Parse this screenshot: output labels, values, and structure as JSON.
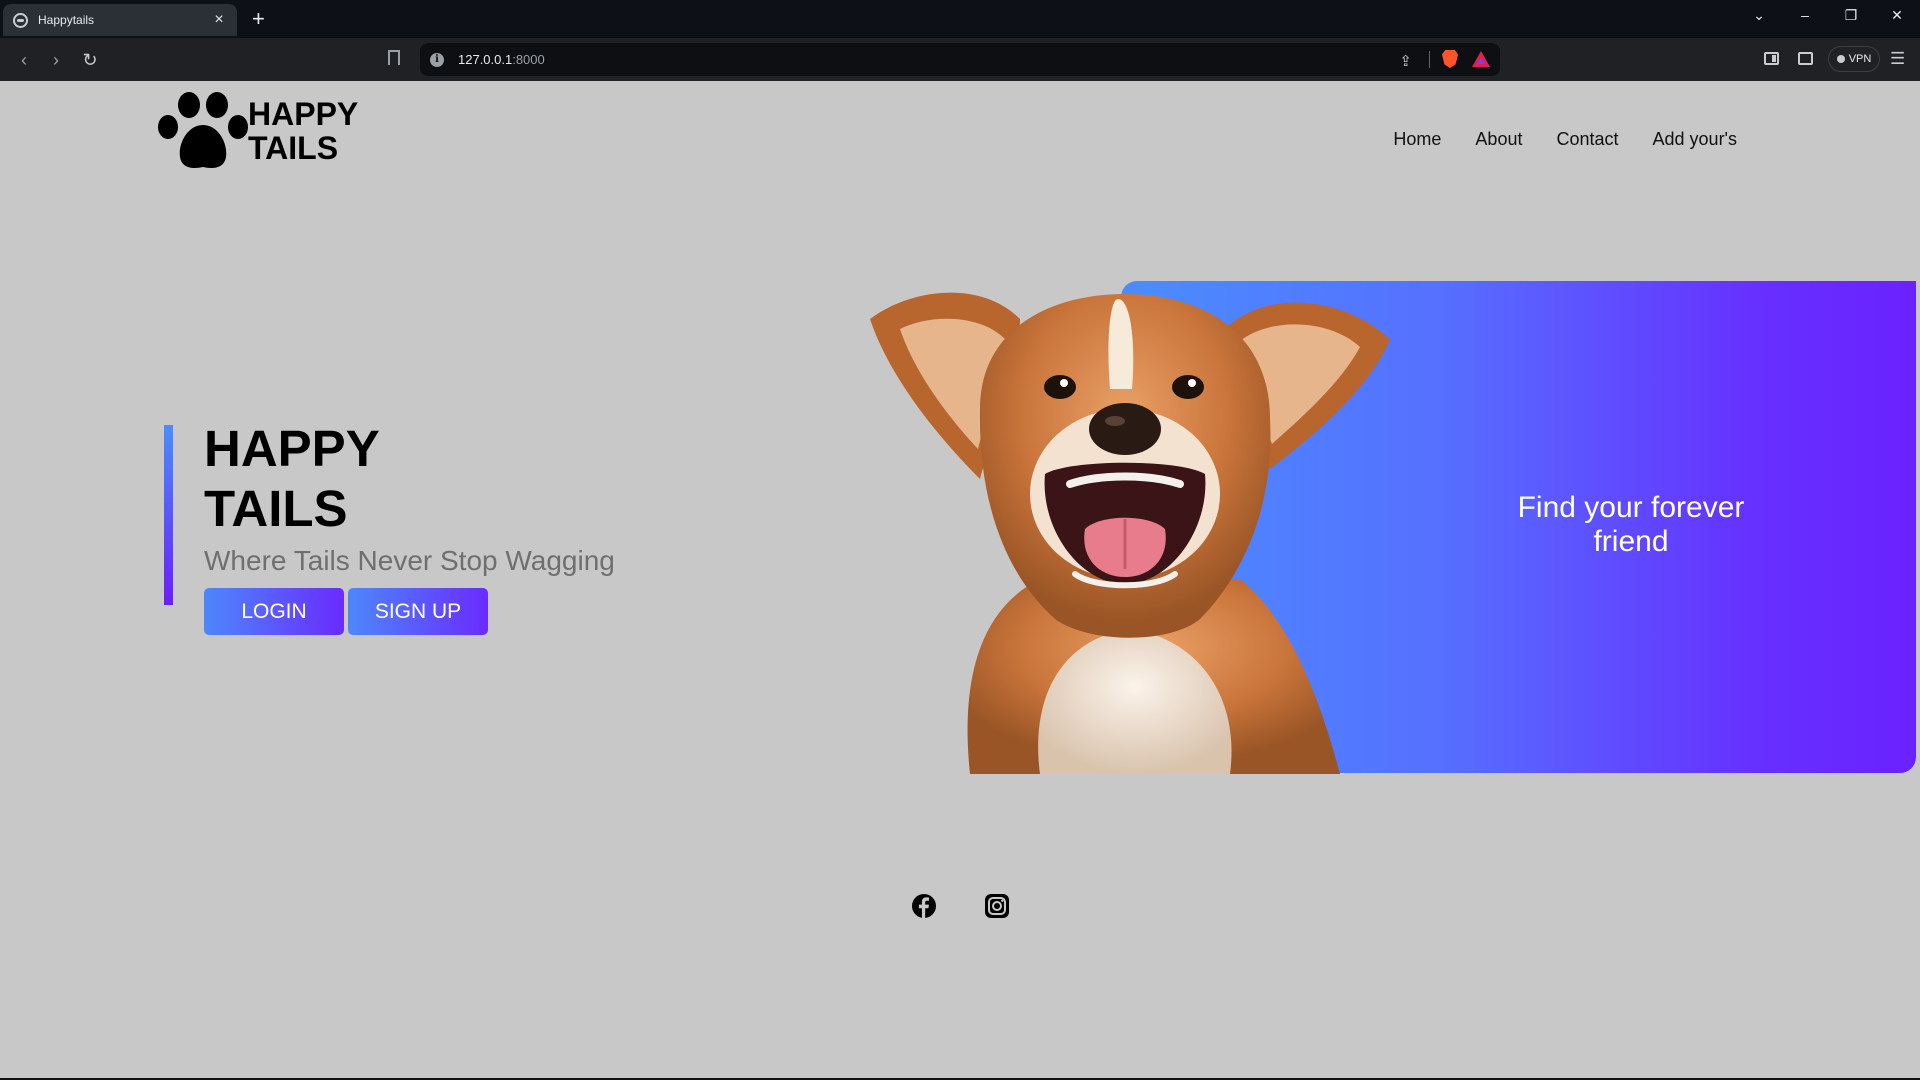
{
  "browser": {
    "tab_title": "Happytails",
    "url_host": "127.0.0.1",
    "url_port": ":8000",
    "vpn_label": "VPN",
    "icons": [
      "globe-icon",
      "close-icon",
      "plus-icon",
      "back-icon",
      "forward-icon",
      "reload-icon",
      "bookmark-icon",
      "info-icon",
      "share-icon",
      "brave-shield-icon",
      "brave-rewards-icon",
      "sidebar-icon",
      "wallet-icon",
      "menu-icon"
    ]
  },
  "header": {
    "logo_line1": "HAPPY",
    "logo_line2": "TAILS",
    "nav": [
      "Home",
      "About",
      "Contact",
      "Add your's"
    ]
  },
  "hero": {
    "title_line1": "HAPPY",
    "title_line2": "TAILS",
    "tagline": "Where Tails Never Stop Wagging",
    "login_label": "LOGIN",
    "signup_label": "SIGN UP",
    "card_text": "Find your forever friend"
  },
  "social": [
    "facebook-icon",
    "instagram-icon"
  ],
  "colors": {
    "page_bg": "#c8c8c8",
    "gradient_start": "#4a8dff",
    "gradient_end": "#6a22ff",
    "tagline": "#6f6f6f"
  }
}
